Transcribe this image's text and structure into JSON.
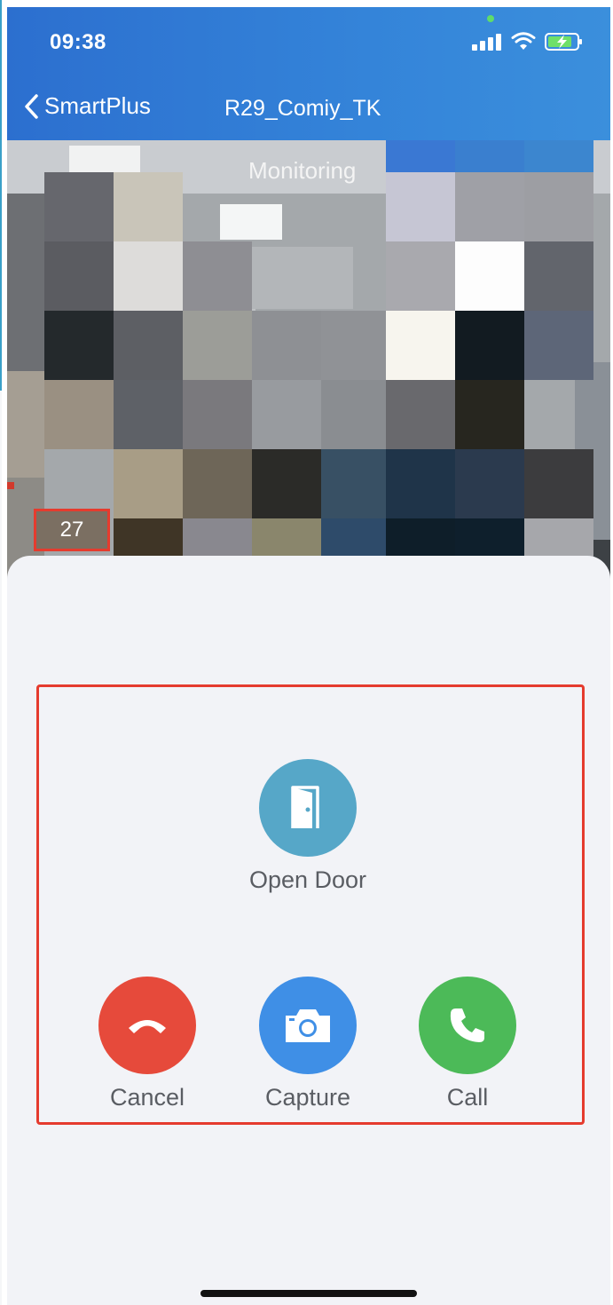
{
  "status_bar": {
    "time": "09:38"
  },
  "nav": {
    "back_label": "SmartPlus",
    "title": "R29_Comiy_TK"
  },
  "video": {
    "status_text": "Monitoring",
    "counter": "27"
  },
  "actions": {
    "open_door": "Open Door",
    "cancel": "Cancel",
    "capture": "Capture",
    "call": "Call"
  },
  "colors": {
    "header": "#3484d9",
    "open_door": "#56a7c8",
    "cancel": "#e64a3b",
    "capture": "#3f8fe6",
    "call": "#4cba58",
    "highlight": "#e53b2e"
  },
  "icons": {
    "back": "chevron-left-icon",
    "open_door": "door-icon",
    "cancel": "hang-up-icon",
    "capture": "camera-icon",
    "call": "phone-icon"
  }
}
